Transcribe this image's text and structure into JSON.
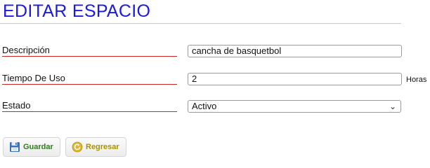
{
  "page": {
    "title": "EDITAR ESPACIO"
  },
  "form": {
    "descripcion": {
      "label": "Descripción",
      "value": "cancha de basquetbol"
    },
    "tiempo_uso": {
      "label": "Tiempo De Uso",
      "value": "2",
      "unit": "Horas"
    },
    "estado": {
      "label": "Estado",
      "selected": "Activo"
    }
  },
  "actions": {
    "save_label": "Guardar",
    "back_label": "Regresar"
  },
  "colors": {
    "title": "#1a1ae6",
    "label_underline": "#cc2222",
    "save_text": "#2e7d1c",
    "back_text": "#a89300"
  },
  "icons": {
    "save": "floppy-disk-icon",
    "back": "back-arrow-icon"
  }
}
